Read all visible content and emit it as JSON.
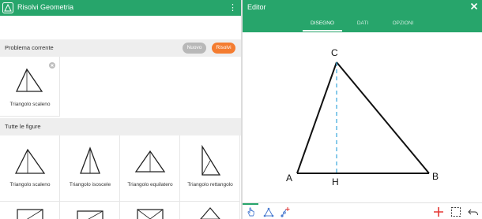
{
  "left": {
    "app_title": "Risolvi Geometria",
    "menu_icon": "more-vert-icon",
    "current_section": {
      "label": "Problema corrente",
      "nuovo_label": "Nuovo",
      "risolvi_label": "Risolvi",
      "current_item": {
        "caption": "Triangolo scaleno",
        "icon": "triangle-scalene-icon"
      }
    },
    "all_section": {
      "label": "Tutte le figure",
      "items": [
        {
          "caption": "Triangolo scaleno",
          "icon": "triangle-scalene-icon"
        },
        {
          "caption": "Triangolo isoscele",
          "icon": "triangle-isosceles-icon"
        },
        {
          "caption": "Triangolo equilatero",
          "icon": "triangle-equilateral-icon"
        },
        {
          "caption": "Triangolo rettangolo",
          "icon": "triangle-right-icon"
        }
      ]
    }
  },
  "right": {
    "title": "Editor",
    "tabs": [
      {
        "label": "DISEGNO",
        "active": true
      },
      {
        "label": "DATI",
        "active": false
      },
      {
        "label": "OPZIONI",
        "active": false
      }
    ],
    "vertices": {
      "a": "A",
      "b": "B",
      "c": "C",
      "h": "H"
    },
    "toolbar": {
      "left_icons": [
        "hand-pointer-icon",
        "triangle-select-icon",
        "add-point-icon"
      ],
      "right_icons": [
        "add-icon",
        "selection-box-icon",
        "undo-icon"
      ]
    }
  },
  "colors": {
    "primary": "#27a56b",
    "accent": "#f47c30",
    "neutral_pill": "#b8b8b8",
    "height_line": "#3aa8dd",
    "add_icon": "#e53935"
  }
}
